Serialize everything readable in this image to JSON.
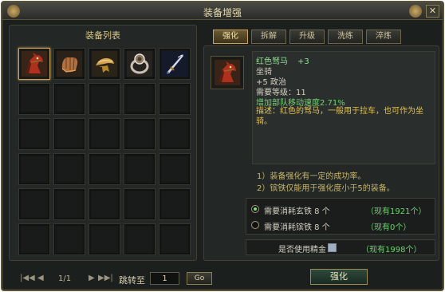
{
  "window": {
    "title": "装备增强",
    "close_label": "✕"
  },
  "left_panel": {
    "header": "装备列表"
  },
  "slots": [
    {
      "icon": "red-horse-icon",
      "selected": true
    },
    {
      "icon": "gauntlet-icon",
      "selected": false
    },
    {
      "icon": "headband-icon",
      "selected": false
    },
    {
      "icon": "ring-icon",
      "selected": false
    },
    {
      "icon": "blade-icon",
      "selected": false
    }
  ],
  "empty_slot_count": 25,
  "tabs": [
    {
      "label": "强化",
      "active": true
    },
    {
      "label": "拆解",
      "active": false
    },
    {
      "label": "升级",
      "active": false
    },
    {
      "label": "洗练",
      "active": false
    },
    {
      "label": "淬炼",
      "active": false
    }
  ],
  "item": {
    "icon": "red-horse-icon",
    "name": "红色驽马",
    "level_plus": "+3",
    "type": "坐骑",
    "stat": "+5 政治",
    "required_level": "需要等级：11",
    "bonus": "增加部队移动速度2.71%",
    "description": "描述：红色的驽马，一般用于拉车，也可作为坐骑。"
  },
  "notes": [
    "1）装备强化有一定的成功率。",
    "2）镔铁仅能用于强化度小于5的装备。"
  ],
  "costs": [
    {
      "label": "需要消耗玄铁  8 个",
      "owned": "（现有1921个）",
      "selected": true
    },
    {
      "label": "需要消耗镔铁  8 个",
      "owned": "（现有0个）",
      "selected": false
    }
  ],
  "refine": {
    "label": "是否使用精金",
    "owned": "（现有1998个）",
    "checked": false
  },
  "pager": {
    "first_label": "|◀◀",
    "prev_label": "◀",
    "page": "1/1",
    "next_label": "▶",
    "last_label": "▶▶|",
    "jump_label": "跳转至",
    "jump_value": "1",
    "go_label": "Go"
  },
  "enhance_button": "强化",
  "colors": {
    "frame": "#5b5236",
    "accent_gold": "#c8a25a",
    "text_green": "#6ed36e",
    "text_yellow": "#e8c24a"
  }
}
